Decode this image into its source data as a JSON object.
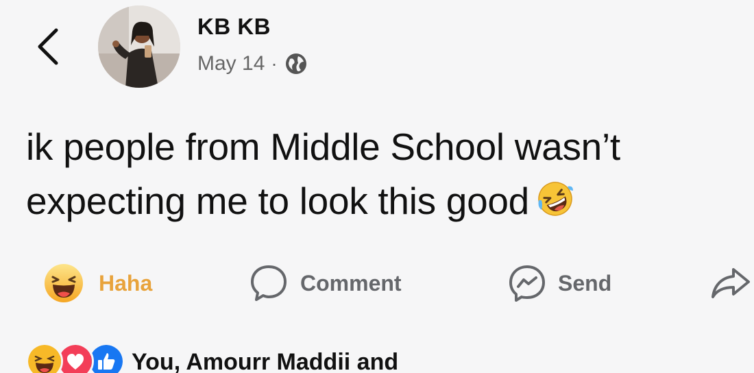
{
  "post": {
    "author": "KB KB",
    "date": "May 14",
    "separator": "·",
    "privacy_icon": "globe-icon",
    "text_lines": [
      "ik people from Middle School wasn’t",
      "expecting me to look this good"
    ],
    "text_emoji": "rolling-on-floor-laughing-emoji"
  },
  "actions": {
    "reaction_label": "Haha",
    "comment_label": "Comment",
    "send_label": "Send"
  },
  "reactions": {
    "icons": [
      "haha-icon",
      "love-icon",
      "like-icon"
    ],
    "summary_text": "You, Amourr Maddii and"
  },
  "colors": {
    "background": "#f6f6f7",
    "haha_accent": "#e8a33c",
    "action_gray": "#65676b",
    "like_blue": "#1877f2",
    "love_red": "#f33e58"
  }
}
